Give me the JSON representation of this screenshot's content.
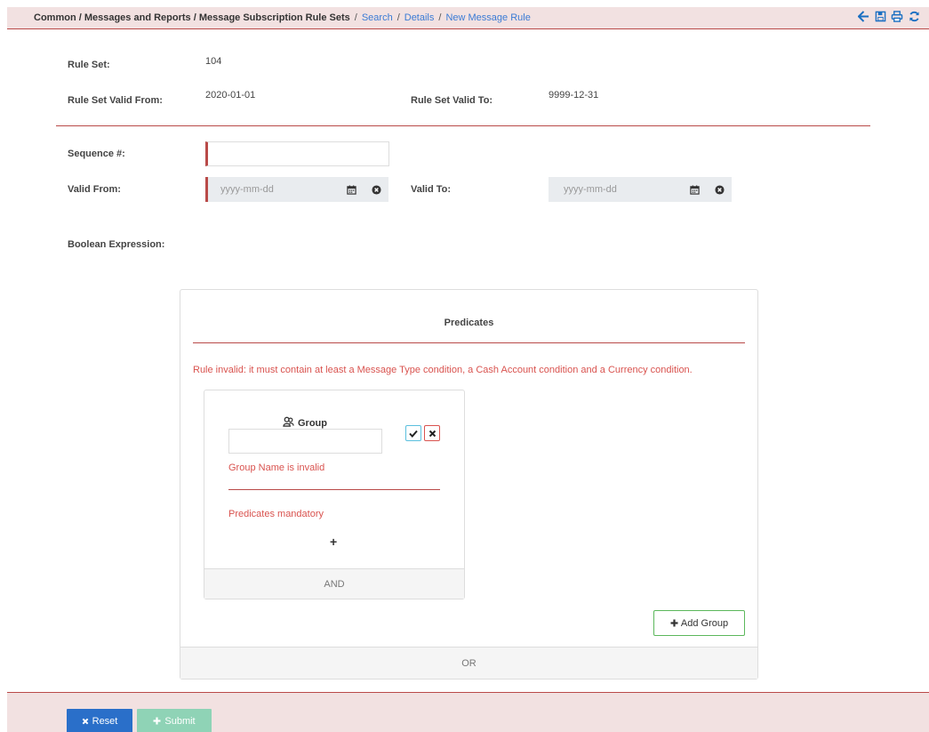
{
  "breadcrumb": {
    "path": "Common / Messages and Reports / Message Subscription Rule Sets",
    "links": [
      "Search",
      "Details",
      "New Message Rule"
    ],
    "separator": "/"
  },
  "toolbar_icons": [
    "back-arrow-icon",
    "save-icon",
    "print-icon",
    "refresh-icon"
  ],
  "header": {
    "rule_set_label": "Rule Set:",
    "rule_set_value": "104",
    "valid_from_label": "Rule Set Valid From:",
    "valid_from_value": "2020-01-01",
    "valid_to_label": "Rule Set Valid To:",
    "valid_to_value": "9999-12-31"
  },
  "form": {
    "sequence_label": "Sequence #:",
    "sequence_value": "",
    "valid_from_label": "Valid From:",
    "valid_from_placeholder": "yyyy-mm-dd",
    "valid_to_label": "Valid To:",
    "valid_to_placeholder": "yyyy-mm-dd",
    "boolean_expression_label": "Boolean Expression:"
  },
  "predicates": {
    "title": "Predicates",
    "error": "Rule invalid: it must contain at least a Message Type condition, a Cash Account condition and a Currency condition.",
    "group": {
      "title": "Group",
      "name_value": "",
      "name_error": "Group Name is invalid",
      "predicates_error": "Predicates mandatory",
      "add_symbol": "+",
      "footer": "AND"
    },
    "add_group_label": "Add Group",
    "footer": "OR"
  },
  "actions": {
    "reset_label": "Reset",
    "submit_label": "Submit",
    "reset_color": "#2a6fc9",
    "submit_color": "#8fd3b6"
  },
  "colors": {
    "accent_red": "#b94a48",
    "error_red": "#d9534f",
    "link_blue": "#3a7bd5",
    "bar_bg": "#f2e1e1"
  }
}
